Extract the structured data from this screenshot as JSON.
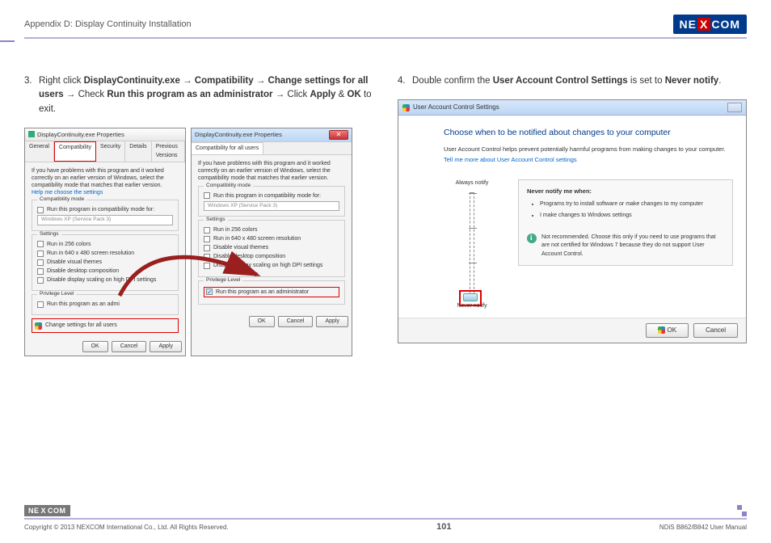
{
  "header": {
    "title": "Appendix D: Display Continuity Installation",
    "logo": "NEXCOM"
  },
  "step3": {
    "num": "3.",
    "text_a": "Right click ",
    "b1": "DisplayContinuity.exe",
    "arrow1": " → ",
    "b2": "Compatibility",
    "arrow2": " → ",
    "b3": "Change settings for all users",
    "arrow3": " → Check ",
    "b4": "Run this program as an administrator",
    "arrow4": " → Click ",
    "b5": "Apply",
    "amp": " & ",
    "b6": "OK",
    "tail": " to exit."
  },
  "props1": {
    "title": "DisplayContinuity.exe Properties",
    "tabs": {
      "general": "General",
      "compat": "Compatibility",
      "security": "Security",
      "details": "Details",
      "prev": "Previous Versions"
    },
    "intro": "If you have problems with this program and it worked correctly on an earlier version of Windows, select the compatibility mode that matches that earlier version.",
    "help": "Help me choose the settings",
    "g_compat": "Compatibility mode",
    "run_compat": "Run this program in compatibility mode for:",
    "xp": "Windows XP (Service Pack 3)",
    "g_settings": "Settings",
    "s256": "Run in 256 colors",
    "s640": "Run in 640 x 480 screen resolution",
    "sthemes": "Disable visual themes",
    "sdesk": "Disable desktop composition",
    "sdpi": "Disable display scaling on high DPI settings",
    "g_priv": "Privilege Level",
    "admin_trunc": "Run this program as an admi",
    "change": "Change settings for all users",
    "ok": "OK",
    "cancel": "Cancel",
    "apply": "Apply"
  },
  "props2": {
    "title": "DisplayContinuity.exe Properties",
    "tab": "Compatibility for all users",
    "intro": "If you have problems with this program and it worked correctly on an earlier version of Windows, select the compatibility mode that matches that earlier version.",
    "admin_full": "Run this program as an administrator"
  },
  "step4": {
    "num": "4.",
    "text_a": "Double confirm the ",
    "b1": "User Account Control Settings",
    "text_b": " is set to ",
    "b2": "Never notify",
    "tail": "."
  },
  "uac": {
    "title": "User Account Control Settings",
    "head": "Choose when to be notified about changes to your computer",
    "sub": "User Account Control helps prevent potentially harmful programs from making changes to your computer.",
    "link": "Tell me more about User Account Control settings",
    "always": "Always notify",
    "never": "Never notify",
    "panel_head": "Never notify me when:",
    "li1": "Programs try to install software or make changes to my computer",
    "li2": "I make changes to Windows settings",
    "warn": "Not recommended. Choose this only if you need to use programs that are not certified for Windows 7 because they do not support User Account Control.",
    "ok": "OK",
    "cancel": "Cancel"
  },
  "footer": {
    "copyright": "Copyright © 2013 NEXCOM International Co., Ltd. All Rights Reserved.",
    "page": "101",
    "manual": "NDiS B862/B842 User Manual"
  }
}
